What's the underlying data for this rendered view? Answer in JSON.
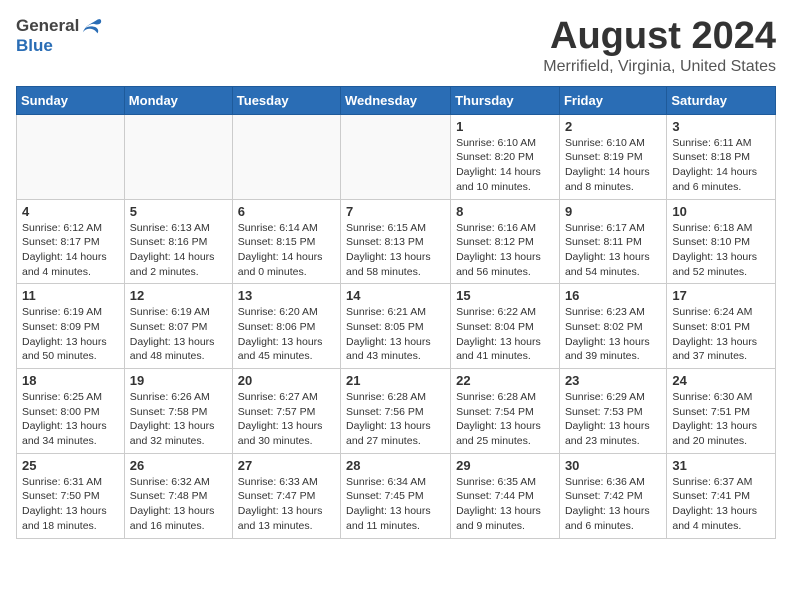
{
  "header": {
    "logo_general": "General",
    "logo_blue": "Blue",
    "month_year": "August 2024",
    "location": "Merrifield, Virginia, United States"
  },
  "weekdays": [
    "Sunday",
    "Monday",
    "Tuesday",
    "Wednesday",
    "Thursday",
    "Friday",
    "Saturday"
  ],
  "weeks": [
    [
      {
        "day": "",
        "info": ""
      },
      {
        "day": "",
        "info": ""
      },
      {
        "day": "",
        "info": ""
      },
      {
        "day": "",
        "info": ""
      },
      {
        "day": "1",
        "info": "Sunrise: 6:10 AM\nSunset: 8:20 PM\nDaylight: 14 hours\nand 10 minutes."
      },
      {
        "day": "2",
        "info": "Sunrise: 6:10 AM\nSunset: 8:19 PM\nDaylight: 14 hours\nand 8 minutes."
      },
      {
        "day": "3",
        "info": "Sunrise: 6:11 AM\nSunset: 8:18 PM\nDaylight: 14 hours\nand 6 minutes."
      }
    ],
    [
      {
        "day": "4",
        "info": "Sunrise: 6:12 AM\nSunset: 8:17 PM\nDaylight: 14 hours\nand 4 minutes."
      },
      {
        "day": "5",
        "info": "Sunrise: 6:13 AM\nSunset: 8:16 PM\nDaylight: 14 hours\nand 2 minutes."
      },
      {
        "day": "6",
        "info": "Sunrise: 6:14 AM\nSunset: 8:15 PM\nDaylight: 14 hours\nand 0 minutes."
      },
      {
        "day": "7",
        "info": "Sunrise: 6:15 AM\nSunset: 8:13 PM\nDaylight: 13 hours\nand 58 minutes."
      },
      {
        "day": "8",
        "info": "Sunrise: 6:16 AM\nSunset: 8:12 PM\nDaylight: 13 hours\nand 56 minutes."
      },
      {
        "day": "9",
        "info": "Sunrise: 6:17 AM\nSunset: 8:11 PM\nDaylight: 13 hours\nand 54 minutes."
      },
      {
        "day": "10",
        "info": "Sunrise: 6:18 AM\nSunset: 8:10 PM\nDaylight: 13 hours\nand 52 minutes."
      }
    ],
    [
      {
        "day": "11",
        "info": "Sunrise: 6:19 AM\nSunset: 8:09 PM\nDaylight: 13 hours\nand 50 minutes."
      },
      {
        "day": "12",
        "info": "Sunrise: 6:19 AM\nSunset: 8:07 PM\nDaylight: 13 hours\nand 48 minutes."
      },
      {
        "day": "13",
        "info": "Sunrise: 6:20 AM\nSunset: 8:06 PM\nDaylight: 13 hours\nand 45 minutes."
      },
      {
        "day": "14",
        "info": "Sunrise: 6:21 AM\nSunset: 8:05 PM\nDaylight: 13 hours\nand 43 minutes."
      },
      {
        "day": "15",
        "info": "Sunrise: 6:22 AM\nSunset: 8:04 PM\nDaylight: 13 hours\nand 41 minutes."
      },
      {
        "day": "16",
        "info": "Sunrise: 6:23 AM\nSunset: 8:02 PM\nDaylight: 13 hours\nand 39 minutes."
      },
      {
        "day": "17",
        "info": "Sunrise: 6:24 AM\nSunset: 8:01 PM\nDaylight: 13 hours\nand 37 minutes."
      }
    ],
    [
      {
        "day": "18",
        "info": "Sunrise: 6:25 AM\nSunset: 8:00 PM\nDaylight: 13 hours\nand 34 minutes."
      },
      {
        "day": "19",
        "info": "Sunrise: 6:26 AM\nSunset: 7:58 PM\nDaylight: 13 hours\nand 32 minutes."
      },
      {
        "day": "20",
        "info": "Sunrise: 6:27 AM\nSunset: 7:57 PM\nDaylight: 13 hours\nand 30 minutes."
      },
      {
        "day": "21",
        "info": "Sunrise: 6:28 AM\nSunset: 7:56 PM\nDaylight: 13 hours\nand 27 minutes."
      },
      {
        "day": "22",
        "info": "Sunrise: 6:28 AM\nSunset: 7:54 PM\nDaylight: 13 hours\nand 25 minutes."
      },
      {
        "day": "23",
        "info": "Sunrise: 6:29 AM\nSunset: 7:53 PM\nDaylight: 13 hours\nand 23 minutes."
      },
      {
        "day": "24",
        "info": "Sunrise: 6:30 AM\nSunset: 7:51 PM\nDaylight: 13 hours\nand 20 minutes."
      }
    ],
    [
      {
        "day": "25",
        "info": "Sunrise: 6:31 AM\nSunset: 7:50 PM\nDaylight: 13 hours\nand 18 minutes."
      },
      {
        "day": "26",
        "info": "Sunrise: 6:32 AM\nSunset: 7:48 PM\nDaylight: 13 hours\nand 16 minutes."
      },
      {
        "day": "27",
        "info": "Sunrise: 6:33 AM\nSunset: 7:47 PM\nDaylight: 13 hours\nand 13 minutes."
      },
      {
        "day": "28",
        "info": "Sunrise: 6:34 AM\nSunset: 7:45 PM\nDaylight: 13 hours\nand 11 minutes."
      },
      {
        "day": "29",
        "info": "Sunrise: 6:35 AM\nSunset: 7:44 PM\nDaylight: 13 hours\nand 9 minutes."
      },
      {
        "day": "30",
        "info": "Sunrise: 6:36 AM\nSunset: 7:42 PM\nDaylight: 13 hours\nand 6 minutes."
      },
      {
        "day": "31",
        "info": "Sunrise: 6:37 AM\nSunset: 7:41 PM\nDaylight: 13 hours\nand 4 minutes."
      }
    ]
  ]
}
